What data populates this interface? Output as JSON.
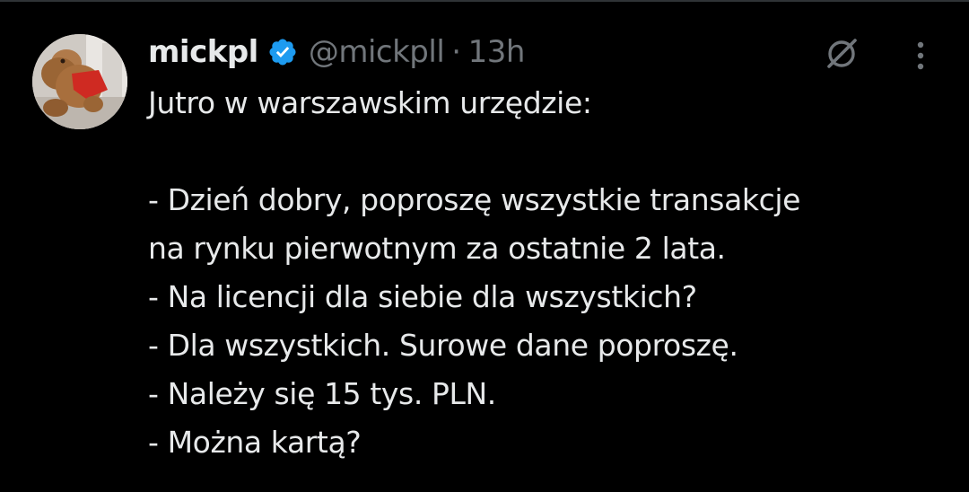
{
  "tweet": {
    "display_name": "mickpl",
    "handle": "@mickpll",
    "separator": "·",
    "time": "13h",
    "verified": true,
    "accent_color": "#1d9bf0",
    "icons": {
      "grok": "grok-icon",
      "more": "more-options-icon",
      "verified": "verified-badge-icon"
    },
    "lines": [
      "Jutro w warszawskim urzędzie:",
      "",
      "- Dzień dobry, poproszę wszystkie transakcje",
      "na rynku pierwotnym za ostatnie 2 lata.",
      "- Na licencji dla siebie dla wszystkich?",
      "- Dla wszystkich. Surowe dane poproszę.",
      "- Należy się 15 tys. PLN.",
      "- Można kartą?"
    ]
  }
}
